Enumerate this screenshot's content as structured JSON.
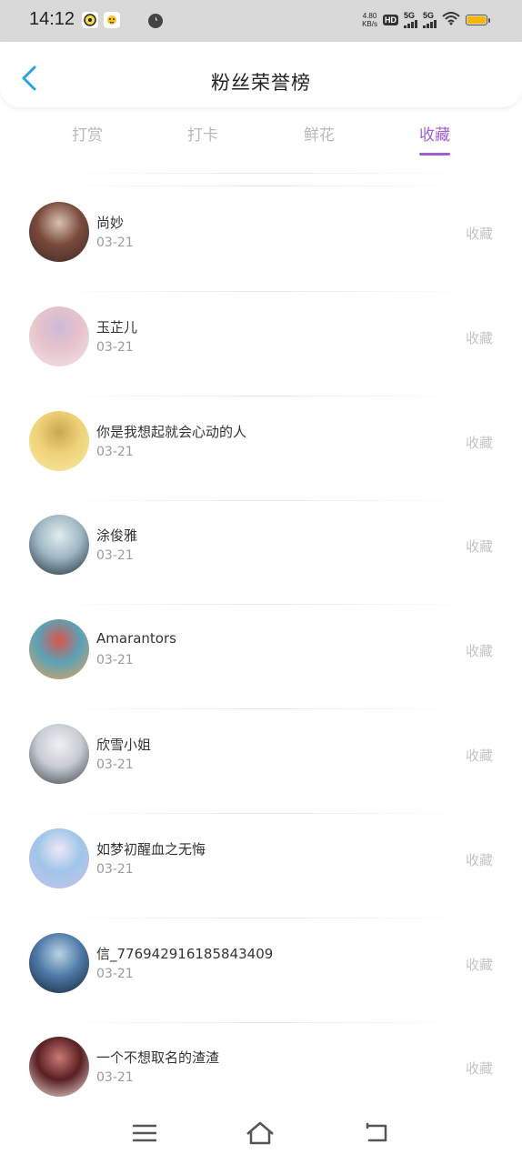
{
  "status_bar": {
    "time": "14:12",
    "net_speed": "4.80",
    "net_unit": "KB/s",
    "hd_label": "HD",
    "sim1_label": "5G",
    "sim2_label": "5G",
    "battery_color": "#f5b700",
    "app_icons": [
      "chat-app-icon",
      "weather-app-icon",
      "compass-icon"
    ]
  },
  "header": {
    "title": "粉丝荣誉榜",
    "back_icon": "chevron-left-icon",
    "accent": "#2aa2e8"
  },
  "tabs": [
    {
      "label": "打赏",
      "active": false
    },
    {
      "label": "打卡",
      "active": false
    },
    {
      "label": "鲜花",
      "active": false
    },
    {
      "label": "收藏",
      "active": true
    }
  ],
  "accent_color": "#a35ed6",
  "fans": [
    {
      "name": "尚妙",
      "date": "03-21",
      "action": "收藏",
      "avatar_colors": [
        "#3a2a26",
        "#7a4a3c",
        "#d8c2b0"
      ]
    },
    {
      "name": "玉芷儿",
      "date": "03-21",
      "action": "收藏",
      "avatar_colors": [
        "#f4e4e6",
        "#e7c3cb",
        "#cdb9d8"
      ]
    },
    {
      "name": "你是我想起就会心动的人",
      "date": "03-21",
      "action": "收藏",
      "avatar_colors": [
        "#f7e9a3",
        "#efd27a",
        "#c9a94e"
      ]
    },
    {
      "name": "涂俊雅",
      "date": "03-21",
      "action": "收藏",
      "avatar_colors": [
        "#1c2a38",
        "#9fb7c4",
        "#e3ecef"
      ]
    },
    {
      "name": "Amarantors",
      "date": "03-21",
      "action": "收藏",
      "avatar_colors": [
        "#e8a35a",
        "#5aa2b8",
        "#d9564a"
      ]
    },
    {
      "name": "欣雪小姐",
      "date": "03-21",
      "action": "收藏",
      "avatar_colors": [
        "#3b3f4a",
        "#c8ccd3",
        "#eef0f3"
      ]
    },
    {
      "name": "如梦初醒血之无悔",
      "date": "03-21",
      "action": "收藏",
      "avatar_colors": [
        "#c9c2ea",
        "#9fc6e8",
        "#ede7f7"
      ]
    },
    {
      "name": "信_776942916185843409",
      "date": "03-21",
      "action": "收藏",
      "avatar_colors": [
        "#14233a",
        "#4f7aa8",
        "#b9d3e3"
      ]
    },
    {
      "name": "一个不想取名的渣渣",
      "date": "03-21",
      "action": "收藏",
      "avatar_colors": [
        "#f2e4e0",
        "#5a1f22",
        "#c97a74"
      ]
    }
  ],
  "nav_bar": {
    "menu_icon": "menu-icon",
    "home_icon": "home-icon",
    "back_icon": "back-icon"
  }
}
